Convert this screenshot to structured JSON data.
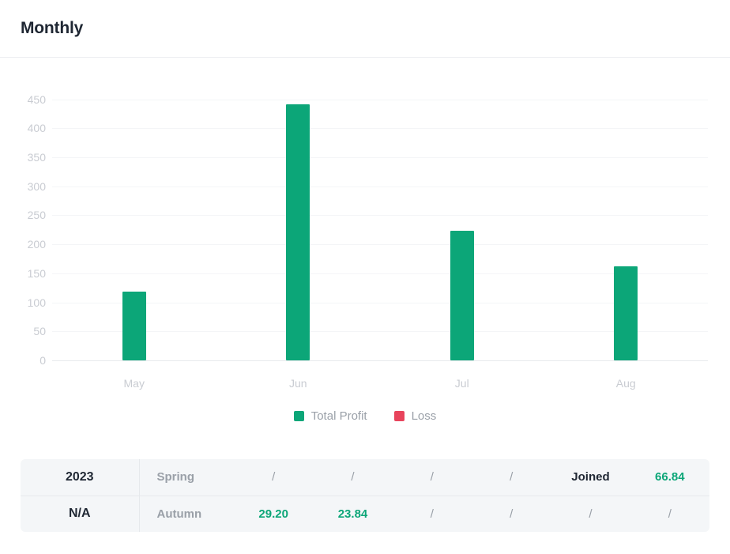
{
  "header": {
    "title": "Monthly"
  },
  "legend": {
    "position": "bottom-center",
    "items": [
      {
        "label": "Total Profit",
        "color": "#0ca678",
        "icon": "square-swatch-icon"
      },
      {
        "label": "Loss",
        "color": "#e8445c",
        "icon": "square-swatch-icon"
      }
    ]
  },
  "chart_data": {
    "type": "bar",
    "title": "Monthly",
    "xlabel": "",
    "ylabel": "",
    "categories": [
      "May",
      "Jun",
      "Jul",
      "Aug"
    ],
    "yticks": [
      0,
      50,
      100,
      150,
      200,
      250,
      300,
      350,
      400,
      450
    ],
    "ylim": [
      0,
      470
    ],
    "grid": true,
    "series": [
      {
        "name": "Total Profit",
        "color": "#0ca678",
        "values": [
          119,
          442,
          223,
          162
        ]
      },
      {
        "name": "Loss",
        "color": "#e8445c",
        "values": [
          0,
          0,
          0,
          0
        ]
      }
    ]
  },
  "table": {
    "rows": [
      {
        "index": "2023",
        "season": "Spring",
        "cells": [
          {
            "text": "/",
            "kind": "empty"
          },
          {
            "text": "/",
            "kind": "empty"
          },
          {
            "text": "/",
            "kind": "empty"
          },
          {
            "text": "/",
            "kind": "empty"
          },
          {
            "text": "Joined",
            "kind": "word"
          },
          {
            "text": "66.84",
            "kind": "num"
          }
        ]
      },
      {
        "index": "N/A",
        "season": "Autumn",
        "cells": [
          {
            "text": "29.20",
            "kind": "num"
          },
          {
            "text": "23.84",
            "kind": "num"
          },
          {
            "text": "/",
            "kind": "empty"
          },
          {
            "text": "/",
            "kind": "empty"
          },
          {
            "text": "/",
            "kind": "empty"
          },
          {
            "text": "/",
            "kind": "empty"
          }
        ]
      }
    ]
  }
}
